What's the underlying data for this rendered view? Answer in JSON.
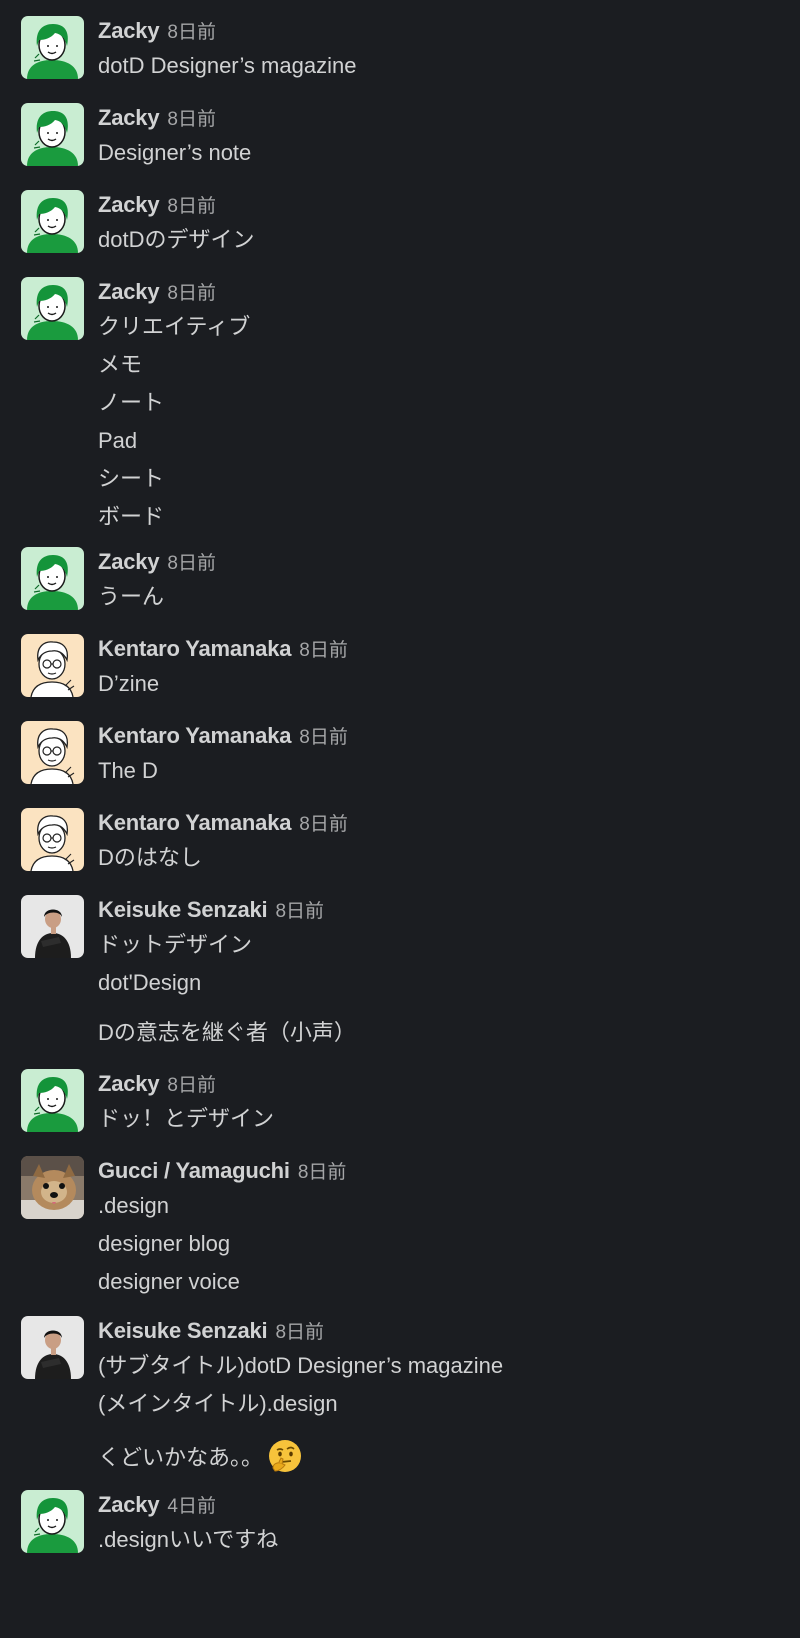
{
  "messages": [
    {
      "author": "Zacky",
      "time": "8日前",
      "avatar": "zacky-avatar",
      "lines": [
        "dotD Designer’s magazine"
      ]
    },
    {
      "author": "Zacky",
      "time": "8日前",
      "avatar": "zacky-avatar",
      "lines": [
        "Designer’s note"
      ]
    },
    {
      "author": "Zacky",
      "time": "8日前",
      "avatar": "zacky-avatar",
      "lines": [
        "dotDのデザイン"
      ]
    },
    {
      "author": "Zacky",
      "time": "8日前",
      "avatar": "zacky-avatar",
      "lines": [
        "クリエイティブ",
        "メモ",
        "ノート",
        "Pad",
        "シート",
        "ボード"
      ]
    },
    {
      "author": "Zacky",
      "time": "8日前",
      "avatar": "zacky-avatar",
      "lines": [
        "うーん"
      ]
    },
    {
      "author": "Kentaro Yamanaka",
      "time": "8日前",
      "avatar": "kentaro-avatar",
      "lines": [
        "D’zine"
      ]
    },
    {
      "author": "Kentaro Yamanaka",
      "time": "8日前",
      "avatar": "kentaro-avatar",
      "lines": [
        "The D"
      ]
    },
    {
      "author": "Kentaro Yamanaka",
      "time": "8日前",
      "avatar": "kentaro-avatar",
      "lines": [
        "Dのはなし"
      ]
    },
    {
      "author": "Keisuke Senzaki",
      "time": "8日前",
      "avatar": "keisuke-avatar",
      "lines": [
        "ドットデザイン",
        "dot'Design",
        "Dの意志を継ぐ者（小声）"
      ]
    },
    {
      "author": "Zacky",
      "time": "8日前",
      "avatar": "zacky-avatar",
      "lines": [
        "ドッ！とデザイン"
      ]
    },
    {
      "author": "Gucci / Yamaguchi",
      "time": "8日前",
      "avatar": "dog-avatar",
      "lines": [
        ".design",
        "designer blog",
        "designer voice"
      ]
    },
    {
      "author": "Keisuke Senzaki",
      "time": "8日前",
      "avatar": "keisuke-avatar",
      "lines": [
        "(サブタイトル)dotD Designer’s magazine",
        "(メインタイトル).design",
        "くどいかなあ。。"
      ],
      "emoji": "thinking-face-icon"
    },
    {
      "author": "Zacky",
      "time": "4日前",
      "avatar": "zacky-avatar",
      "lines": [
        ".designいいですね"
      ]
    }
  ],
  "colors": {
    "background": "#1b1d21",
    "text": "#d1d2d3",
    "timestamp": "#a5a6a8"
  }
}
